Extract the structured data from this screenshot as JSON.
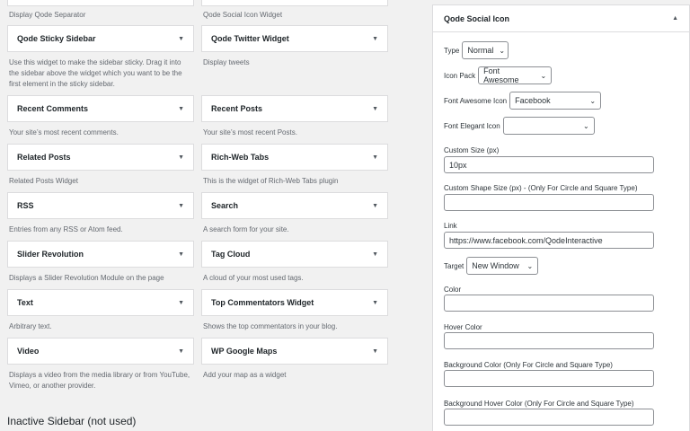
{
  "left_col": {
    "top_desc": "Display Qode Separator",
    "widgets": [
      {
        "title": "Qode Sticky Sidebar",
        "desc": "Use this widget to make the sidebar sticky. Drag it into the sidebar above the widget which you want to be the first element in the sticky sidebar."
      },
      {
        "title": "Recent Comments",
        "desc": "Your site’s most recent comments."
      },
      {
        "title": "Related Posts",
        "desc": "Related Posts Widget"
      },
      {
        "title": "RSS",
        "desc": "Entries from any RSS or Atom feed."
      },
      {
        "title": "Slider Revolution",
        "desc": "Displays a Slider Revolution Module on the page"
      },
      {
        "title": "Text",
        "desc": "Arbitrary text."
      },
      {
        "title": "Video",
        "desc": "Displays a video from the media library or from YouTube, Vimeo, or another provider."
      }
    ]
  },
  "right_col": {
    "top_desc": "Qode Social Icon Widget",
    "widgets": [
      {
        "title": "Qode Twitter Widget",
        "desc": "Display tweets"
      },
      {
        "title": "Recent Posts",
        "desc": "Your site’s most recent Posts."
      },
      {
        "title": "Rich-Web Tabs",
        "desc": "This is the widget of Rich-Web Tabs plugin"
      },
      {
        "title": "Search",
        "desc": "A search form for your site."
      },
      {
        "title": "Tag Cloud",
        "desc": "A cloud of your most used tags."
      },
      {
        "title": "Top Commentators Widget",
        "desc": "Shows the top commentators in your blog."
      },
      {
        "title": "WP Google Maps",
        "desc": "Add your map as a widget"
      }
    ]
  },
  "inactive_heading": "Inactive Sidebar (not used)",
  "panel": {
    "title": "Qode Social Icon",
    "type_label": "Type",
    "type_value": "Normal",
    "icon_pack_label": "Icon Pack",
    "icon_pack_value": "Font Awesome",
    "fa_icon_label": "Font Awesome Icon",
    "fa_icon_value": "Facebook",
    "fe_icon_label": "Font Elegant Icon",
    "fe_icon_value": "",
    "custom_size_label": "Custom Size (px)",
    "custom_size_value": "10px",
    "shape_size_label": "Custom Shape Size (px) - (Only For Circle and Square Type)",
    "shape_size_value": "",
    "link_label": "Link",
    "link_value": "https://www.facebook.com/QodeInteractive",
    "target_label": "Target",
    "target_value": "New Window",
    "color_label": "Color",
    "hover_color_label": "Hover Color",
    "bg_color_label": "Background Color (Only For Circle and Square Type)",
    "bg_hover_color_label": "Background Hover Color (Only For Circle and Square Type)"
  }
}
